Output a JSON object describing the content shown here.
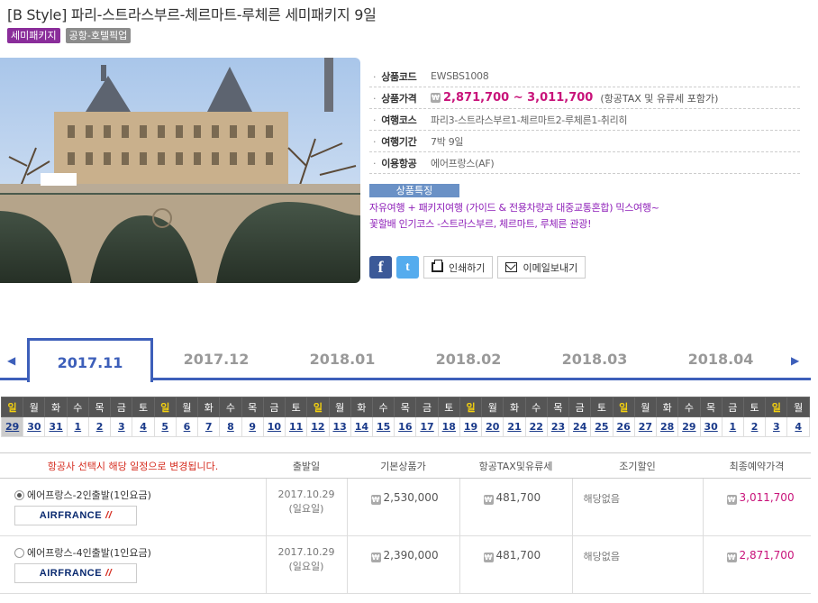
{
  "product": {
    "title": "[B Style] 파리-스트라스부르-체르마트-루체른 세미패키지 9일",
    "badges": [
      "세미패키지",
      "공항-호텔픽업"
    ]
  },
  "info": {
    "rows": [
      {
        "label": "상품코드",
        "value": "EWSBS1008"
      },
      {
        "label": "상품가격",
        "value": "2,871,700 ~ 3,011,700",
        "note": "(항공TAX 및 유류세 포함가)"
      },
      {
        "label": "여행코스",
        "value": "파리3-스트라스부르1-체르마트2-루체른1-취리히"
      },
      {
        "label": "여행기간",
        "value": "7박 9일"
      },
      {
        "label": "이용항공",
        "value": "에어프랑스(AF)"
      }
    ],
    "won_symbol": "₩"
  },
  "feature": {
    "heading": "상품특징",
    "lines": [
      "자유여행 + 패키지여행 (가이드 & 전용차량과 대중교통혼합) 믹스여행~",
      "꽃할배 인기코스 -스트라스부르, 체르마트, 루체른 관광!"
    ]
  },
  "share": {
    "facebook": "f",
    "twitter": "t",
    "print_label": "인쇄하기",
    "email_label": "이메일보내기"
  },
  "months": {
    "prev": "◀",
    "next": "▶",
    "tabs": [
      "2017.11",
      "2017.12",
      "2018.01",
      "2018.02",
      "2018.03",
      "2018.04"
    ],
    "active_index": 0
  },
  "calendar": {
    "weekdays": [
      "일",
      "월",
      "화",
      "수",
      "목",
      "금",
      "토",
      "일",
      "월",
      "화",
      "수",
      "목",
      "금",
      "토",
      "일",
      "월",
      "화",
      "수",
      "목",
      "금",
      "토",
      "일",
      "월",
      "화",
      "수",
      "목",
      "금",
      "토",
      "일",
      "월",
      "화",
      "수",
      "목",
      "금",
      "토",
      "일",
      "월"
    ],
    "days": [
      "29",
      "30",
      "31",
      "1",
      "2",
      "3",
      "4",
      "5",
      "6",
      "7",
      "8",
      "9",
      "10",
      "11",
      "12",
      "13",
      "14",
      "15",
      "16",
      "17",
      "18",
      "19",
      "20",
      "21",
      "22",
      "23",
      "24",
      "25",
      "26",
      "27",
      "28",
      "29",
      "30",
      "1",
      "2",
      "3",
      "4"
    ],
    "selected_index": 0
  },
  "flights": {
    "headers": {
      "notice": "항공사 선택시 해당 일정으로 변경됩니다.",
      "departure": "출발일",
      "base": "기본상품가",
      "tax": "항공TAX및유류세",
      "early": "조기할인",
      "final": "최종예약가격"
    },
    "rows": [
      {
        "option": "에어프랑스-2인출발(1인요금)",
        "airline_logo": "AIRFRANCE",
        "date": "2017.10.29",
        "weekday": "(일요일)",
        "base": "2,530,000",
        "tax": "481,700",
        "early": "해당없음",
        "final": "3,011,700",
        "selected": true
      },
      {
        "option": "에어프랑스-4인출발(1인요금)",
        "airline_logo": "AIRFRANCE",
        "date": "2017.10.29",
        "weekday": "(일요일)",
        "base": "2,390,000",
        "tax": "481,700",
        "early": "해당없음",
        "final": "2,871,700",
        "selected": false
      }
    ]
  },
  "colors": {
    "accent_blue": "#3d5fba",
    "price_pink": "#c8137a",
    "badge_purple": "#8a2d9a",
    "feature_purple": "#8e1fb8",
    "sunday_yellow": "#f4d10f"
  }
}
